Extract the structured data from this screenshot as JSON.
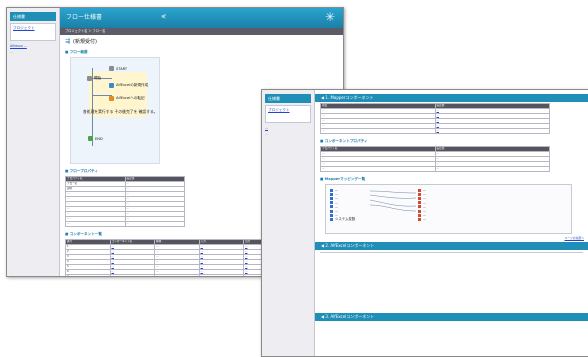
{
  "window1": {
    "sidebar": {
      "title": "仕様書",
      "project_link": "プロジェクト",
      "link_text": "Alfresco\n...",
      "footer_text": "..."
    },
    "header": {
      "title": "フロー仕様書",
      "share_icon": "share-icon",
      "logo_icon": "bird-logo-icon"
    },
    "breadcrumb": "プロジェクト名 ＞ フロー名",
    "page_title": "(新規受付)",
    "flow_section": "フロー概要",
    "flow_nodes": [
      {
        "label": "START",
        "icon": "gear-icon"
      },
      {
        "label": "開始",
        "icon": "gear-icon"
      },
      {
        "label": "AlfExcelの新規作成",
        "icon": "output-icon"
      },
      {
        "label": "AlfExcelへの転記",
        "icon": "input-icon"
      },
      {
        "label": "END",
        "icon": "end-icon"
      }
    ],
    "flow_note": "各処理を実行する\nその後完了を\n確認する。",
    "props_section": "フロープロパティ",
    "props_table": {
      "headers": [
        "プロパティ名",
        "設定値"
      ],
      "rows": [
        [
          "フロー名",
          "..."
        ],
        [
          "説明",
          "..."
        ],
        [
          "...",
          "..."
        ],
        [
          "...",
          "..."
        ],
        [
          "...",
          "..."
        ],
        [
          "...",
          "..."
        ],
        [
          "...",
          "..."
        ],
        [
          "...",
          "..."
        ],
        [
          "...",
          "..."
        ]
      ]
    },
    "components_section": "コンポーネント一覧",
    "comp_table": {
      "headers": [
        "番号",
        "コンポーネント名",
        "種類",
        "入力",
        "出力",
        "説明"
      ],
      "rows": [
        [
          "1",
          "...",
          "...",
          "...",
          "...",
          "..."
        ],
        [
          "2",
          "...",
          "...",
          "...",
          "...",
          "..."
        ],
        [
          "3",
          "...",
          "...",
          "...",
          "...",
          "..."
        ],
        [
          "4",
          "...",
          "...",
          "...",
          "...",
          "..."
        ],
        [
          "5",
          "...",
          "...",
          "...",
          "...",
          "..."
        ],
        [
          "6",
          "...",
          "...",
          "...",
          "...",
          "..."
        ],
        [
          "7",
          "...",
          "...",
          "...",
          "...",
          "..."
        ]
      ]
    }
  },
  "window2": {
    "sidebar": {
      "title": "仕様書",
      "project_link": "プロジェクト",
      "link_text": "...",
      "footer_text": "..."
    },
    "bar1": "1. Mapperコンポーネント",
    "mapper_table": {
      "headers": [
        "項目",
        "設定値"
      ],
      "rows": [
        [
          "...",
          "..."
        ],
        [
          "...",
          "..."
        ],
        [
          "...",
          "..."
        ],
        [
          "...",
          "..."
        ],
        [
          "...",
          "..."
        ]
      ]
    },
    "props_section": "コンポーネントプロパティ",
    "props_table": {
      "headers": [
        "プロパティ名",
        "設定値"
      ],
      "rows": [
        [
          "...",
          "..."
        ],
        [
          "...",
          "..."
        ],
        [
          "...",
          "..."
        ],
        [
          "...",
          "..."
        ]
      ]
    },
    "map_section": "Mapperマッピング一覧",
    "map_left": [
      "...",
      "...",
      "...",
      "...",
      "...",
      "...",
      "...",
      "システム変数"
    ],
    "map_right": [
      "...",
      "...",
      "...",
      "...",
      "...",
      "...",
      "...",
      "..."
    ],
    "bar2": "2. AlfExcelコンポーネント",
    "bar3": "3. AlfExcelコンポーネント",
    "page_link": "ページの先頭へ"
  }
}
